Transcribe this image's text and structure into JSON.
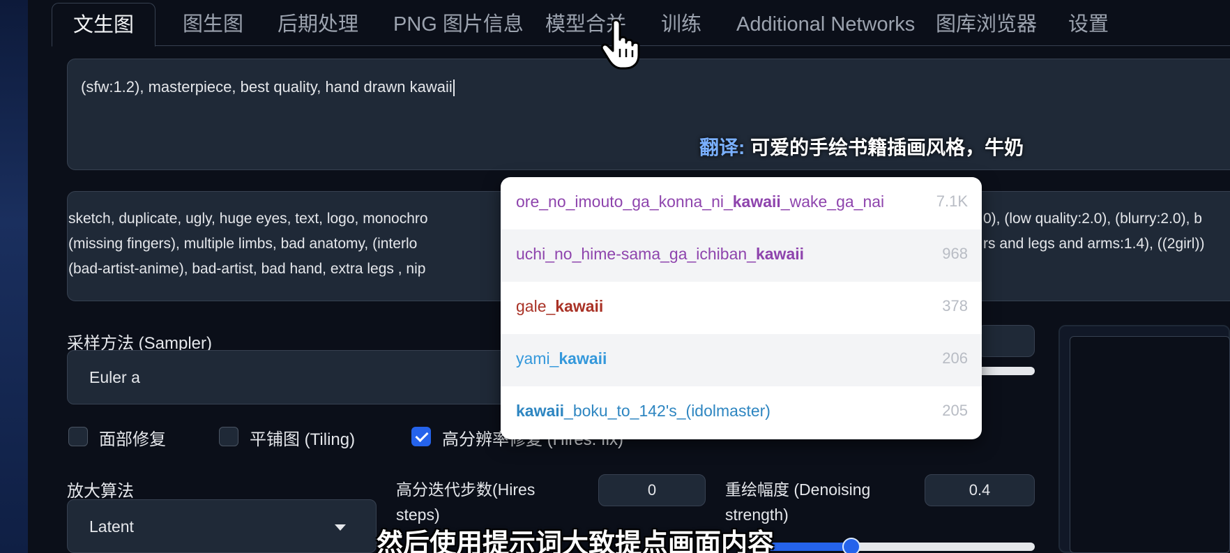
{
  "tabs": [
    {
      "label": "文生图",
      "active": true
    },
    {
      "label": "图生图"
    },
    {
      "label": "后期处理"
    },
    {
      "label": "PNG 图片信息"
    },
    {
      "label": "模型合并"
    },
    {
      "label": "训练"
    },
    {
      "label": "Additional Networks"
    },
    {
      "label": "图库浏览器"
    },
    {
      "label": "设置"
    }
  ],
  "prompt": {
    "value": "(sfw:1.2), masterpiece, best quality, hand drawn kawaii"
  },
  "overlay_translation": {
    "lead": "翻译:",
    "text": "可爱的手绘书籍插画风格，牛奶"
  },
  "negative_prompt": {
    "line1_left": "sketch, duplicate, ugly, huge eyes, text, logo, monochro",
    "line1_right": "0), (low quality:2.0), (blurry:2.0), b",
    "line2_left": "(missing fingers), multiple limbs, bad anatomy, (interlo",
    "line2_right": "rs and legs and arms:1.4), ((2girl))",
    "line3_left": "(bad-artist-anime), bad-artist, bad hand, extra legs , nip"
  },
  "sampler": {
    "label": "采样方法 (Sampler)",
    "value": "Euler a"
  },
  "checkboxes": [
    {
      "label": "面部修复",
      "checked": false
    },
    {
      "label": "平铺图 (Tiling)",
      "checked": false
    },
    {
      "label": "高分辨率修复 (Hires. fix)",
      "checked": true
    }
  ],
  "upscaler": {
    "label": "放大算法",
    "value": "Latent"
  },
  "hires_steps": {
    "label": "高分迭代步数(Hires steps)",
    "value": "0"
  },
  "denoising": {
    "label": "重绘幅度 (Denoising strength)",
    "value": "0.4"
  },
  "autocomplete": [
    {
      "pre": "ore_no_imouto_ga_konna_ni_",
      "match": "kawaii",
      "post": "_wake_ga_nai",
      "count": "7.1K",
      "color": "#8e44ad"
    },
    {
      "pre": "uchi_no_hime-sama_ga_ichiban_",
      "match": "kawaii",
      "post": "",
      "count": "968",
      "color": "#8e44ad"
    },
    {
      "pre": "gale_",
      "match": "kawaii",
      "post": "",
      "count": "378",
      "color": "#a93226"
    },
    {
      "pre": "yami_",
      "match": "kawaii",
      "post": "",
      "count": "206",
      "color": "#3498db"
    },
    {
      "pre": "",
      "match": "kawaii",
      "post": "_boku_to_142's_(idolmaster)",
      "count": "205",
      "color": "#2e86c1"
    }
  ],
  "subtitle": "然后使用提示词大致提点画面内容",
  "colors": {
    "accent": "#2563eb",
    "background": "#0b0f19",
    "panel": "#1f2937"
  }
}
